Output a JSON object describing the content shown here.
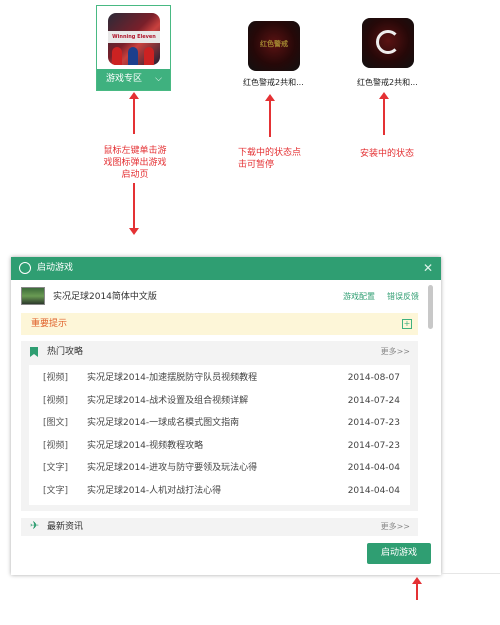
{
  "tiles": {
    "selected": {
      "thumb_text": "Winning Eleven",
      "bar_label": "游戏专区",
      "chevron": "⌵"
    },
    "downloading": {
      "thumb_text": "红色警戒",
      "label": "红色警戒2共和..."
    },
    "installing": {
      "label": "红色警戒2共和..."
    }
  },
  "notes": {
    "left": [
      "鼠标左键单击游",
      "戏图标弹出游戏",
      "启动页"
    ],
    "middle": [
      "下载中的状态点",
      "击可暂停"
    ],
    "right": "安装中的状态"
  },
  "window": {
    "title": "启动游戏",
    "close": "✕",
    "game_name": "实况足球2014简体中文版",
    "links": {
      "config": "游戏配置",
      "report": "错误反馈"
    },
    "notice": "重要提示",
    "notice_expand": "+",
    "hot_section": {
      "heading": "热门攻略",
      "more": "更多>>",
      "rows": [
        {
          "tag": "[视频]",
          "title": "实况足球2014-加速摆脱防守队员视频教程",
          "date": "2014-08-07"
        },
        {
          "tag": "[视频]",
          "title": "实况足球2014-战术设置及组合视频详解",
          "date": "2014-07-24"
        },
        {
          "tag": "[图文]",
          "title": "实况足球2014-一球成名模式图文指南",
          "date": "2014-07-23"
        },
        {
          "tag": "[视频]",
          "title": "实况足球2014-视频教程攻略",
          "date": "2014-07-23"
        },
        {
          "tag": "[文字]",
          "title": "实况足球2014-进攻与防守要领及玩法心得",
          "date": "2014-04-04"
        },
        {
          "tag": "[文字]",
          "title": "实况足球2014-人机对战打法心得",
          "date": "2014-04-04"
        }
      ]
    },
    "news_section": {
      "heading": "最新资讯",
      "more": "更多>>"
    },
    "launch_button": "启动游戏"
  },
  "colors": {
    "accent": "#2f9e72",
    "annotation": "#e43134",
    "notice_bg": "#fdf6d8",
    "notice_text": "#e0612b"
  }
}
